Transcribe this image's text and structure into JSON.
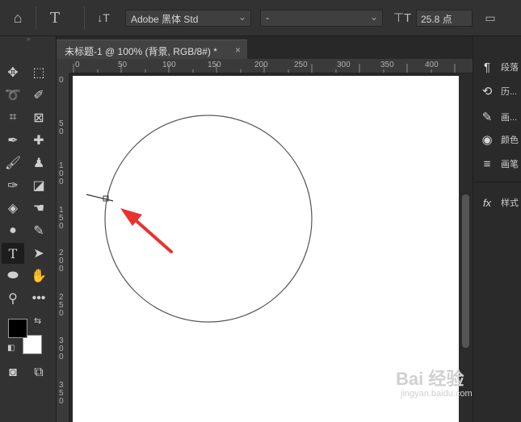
{
  "options_bar": {
    "font_family": "Adobe 黑体 Std",
    "font_style": "-",
    "font_size": "25.8 点"
  },
  "document_tab": {
    "title": "未标题-1 @ 100% (背景, RGB/8#) *",
    "close": "×"
  },
  "rulers": {
    "horizontal": [
      "0",
      "50",
      "100",
      "150",
      "200",
      "250",
      "300",
      "350",
      "400"
    ],
    "vertical": [
      "0",
      "5 0",
      "1 0 0",
      "1 5 0",
      "2 0 0",
      "2 5 0",
      "3 0 0",
      "3 5 0"
    ]
  },
  "panels": {
    "items": [
      {
        "icon": "¶",
        "label": "段落"
      },
      {
        "icon": "⟲",
        "label": "历..."
      },
      {
        "icon": "✎",
        "label": "画..."
      },
      {
        "icon": "◉",
        "label": "颜色"
      },
      {
        "icon": "≡",
        "label": "画笔"
      },
      {
        "icon": "fx",
        "label": "样式"
      }
    ]
  },
  "watermark": {
    "brand": "Bai 经验",
    "url": "jingyan.baidu.com"
  },
  "colors": {
    "foreground": "#000000",
    "background": "#ffffff",
    "annotation_arrow": "#e8322f"
  }
}
